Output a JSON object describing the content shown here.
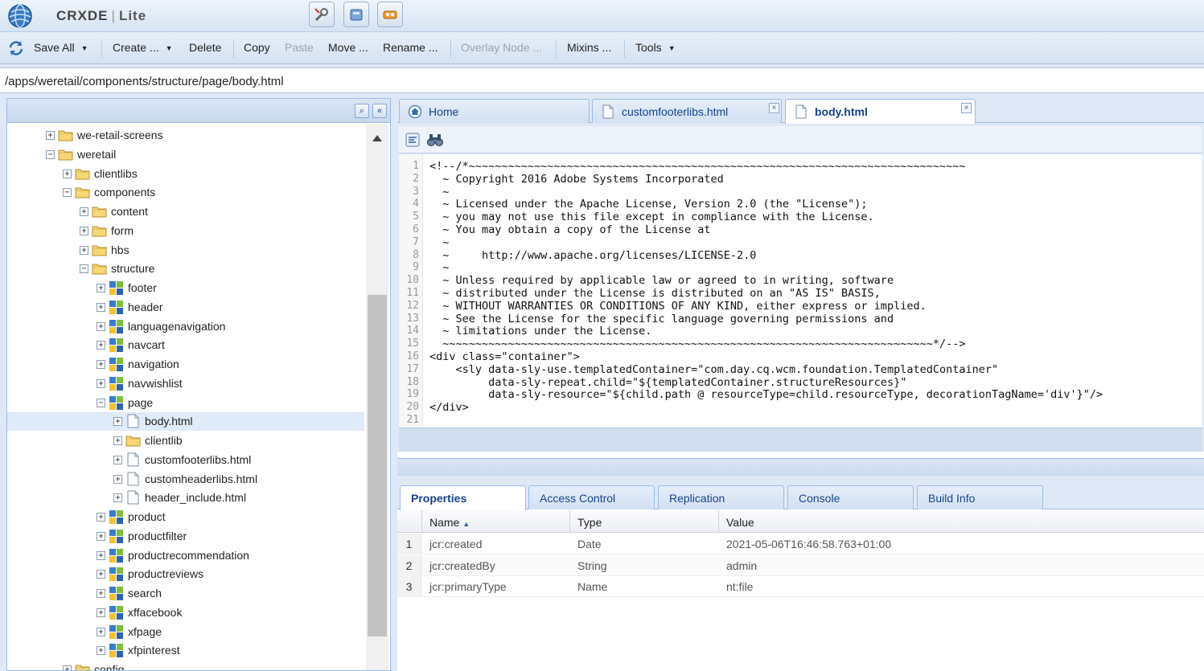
{
  "header": {
    "app_name": "CRXDE",
    "app_sub": "Lite"
  },
  "toolbar": {
    "save_all": "Save All",
    "create": "Create ...",
    "delete": "Delete",
    "copy": "Copy",
    "paste": "Paste",
    "move": "Move ...",
    "rename": "Rename ...",
    "overlay": "Overlay Node ...",
    "mixins": "Mixins ...",
    "tools": "Tools"
  },
  "path": "/apps/weretail/components/structure/page/body.html",
  "tree": {
    "items": [
      {
        "label": "we-retail-screens",
        "depth": 0,
        "icon": "folder-icon",
        "expanded": false
      },
      {
        "label": "weretail",
        "depth": 0,
        "icon": "folder-icon",
        "expanded": true
      },
      {
        "label": "clientlibs",
        "depth": 1,
        "icon": "folder-icon",
        "expanded": false
      },
      {
        "label": "components",
        "depth": 1,
        "icon": "folder-icon",
        "expanded": true
      },
      {
        "label": "content",
        "depth": 2,
        "icon": "folder-icon",
        "expanded": false
      },
      {
        "label": "form",
        "depth": 2,
        "icon": "folder-icon",
        "expanded": false
      },
      {
        "label": "hbs",
        "depth": 2,
        "icon": "folder-icon",
        "expanded": false
      },
      {
        "label": "structure",
        "depth": 2,
        "icon": "folder-icon",
        "expanded": true
      },
      {
        "label": "footer",
        "depth": 3,
        "icon": "component-icon",
        "expanded": false
      },
      {
        "label": "header",
        "depth": 3,
        "icon": "component-icon",
        "expanded": false
      },
      {
        "label": "languagenavigation",
        "depth": 3,
        "icon": "component-icon",
        "expanded": false
      },
      {
        "label": "navcart",
        "depth": 3,
        "icon": "component-icon",
        "expanded": false
      },
      {
        "label": "navigation",
        "depth": 3,
        "icon": "component-icon",
        "expanded": false
      },
      {
        "label": "navwishlist",
        "depth": 3,
        "icon": "component-icon",
        "expanded": false
      },
      {
        "label": "page",
        "depth": 3,
        "icon": "component-icon",
        "expanded": true
      },
      {
        "label": "body.html",
        "depth": 4,
        "icon": "file-icon",
        "expanded": false,
        "selected": true
      },
      {
        "label": "clientlib",
        "depth": 4,
        "icon": "folder-icon",
        "expanded": false
      },
      {
        "label": "customfooterlibs.html",
        "depth": 4,
        "icon": "file-icon",
        "expanded": false
      },
      {
        "label": "customheaderlibs.html",
        "depth": 4,
        "icon": "file-icon",
        "expanded": false
      },
      {
        "label": "header_include.html",
        "depth": 4,
        "icon": "file-icon",
        "expanded": false
      },
      {
        "label": "product",
        "depth": 3,
        "icon": "component-icon",
        "expanded": false
      },
      {
        "label": "productfilter",
        "depth": 3,
        "icon": "component-icon",
        "expanded": false
      },
      {
        "label": "productrecommendation",
        "depth": 3,
        "icon": "component-icon",
        "expanded": false
      },
      {
        "label": "productreviews",
        "depth": 3,
        "icon": "component-icon",
        "expanded": false
      },
      {
        "label": "search",
        "depth": 3,
        "icon": "component-icon",
        "expanded": false
      },
      {
        "label": "xffacebook",
        "depth": 3,
        "icon": "component-icon",
        "expanded": false
      },
      {
        "label": "xfpage",
        "depth": 3,
        "icon": "component-icon",
        "expanded": false
      },
      {
        "label": "xfpinterest",
        "depth": 3,
        "icon": "component-icon",
        "expanded": false
      },
      {
        "label": "config",
        "depth": 1,
        "icon": "folder-icon",
        "expanded": false
      }
    ]
  },
  "editor": {
    "tabs": [
      {
        "label": "Home",
        "icon": "home-icon",
        "active": false,
        "closable": false
      },
      {
        "label": "customfooterlibs.html",
        "icon": "file-icon",
        "active": false,
        "closable": true
      },
      {
        "label": "body.html",
        "icon": "file-icon",
        "active": true,
        "closable": true
      }
    ],
    "lines": [
      "<!--/*~~~~~~~~~~~~~~~~~~~~~~~~~~~~~~~~~~~~~~~~~~~~~~~~~~~~~~~~~~~~~~~~~~~~~~~~~~~~",
      "  ~ Copyright 2016 Adobe Systems Incorporated",
      "  ~",
      "  ~ Licensed under the Apache License, Version 2.0 (the \"License\");",
      "  ~ you may not use this file except in compliance with the License.",
      "  ~ You may obtain a copy of the License at",
      "  ~",
      "  ~     http://www.apache.org/licenses/LICENSE-2.0",
      "  ~",
      "  ~ Unless required by applicable law or agreed to in writing, software",
      "  ~ distributed under the License is distributed on an \"AS IS\" BASIS,",
      "  ~ WITHOUT WARRANTIES OR CONDITIONS OF ANY KIND, either express or implied.",
      "  ~ See the License for the specific language governing permissions and",
      "  ~ limitations under the License.",
      "  ~~~~~~~~~~~~~~~~~~~~~~~~~~~~~~~~~~~~~~~~~~~~~~~~~~~~~~~~~~~~~~~~~~~~~~~~~~~*/-->",
      "<div class=\"container\">",
      "    <sly data-sly-use.templatedContainer=\"com.day.cq.wcm.foundation.TemplatedContainer\"",
      "         data-sly-repeat.child=\"${templatedContainer.structureResources}\"",
      "         data-sly-resource=\"${child.path @ resourceType=child.resourceType, decorationTagName='div'}\"/>",
      "</div>",
      ""
    ]
  },
  "bottom": {
    "tabs": [
      {
        "label": "Properties",
        "active": true
      },
      {
        "label": "Access Control",
        "active": false
      },
      {
        "label": "Replication",
        "active": false
      },
      {
        "label": "Console",
        "active": false
      },
      {
        "label": "Build Info",
        "active": false
      }
    ],
    "columns": {
      "name": "Name",
      "type": "Type",
      "value": "Value"
    },
    "rows": [
      {
        "num": "1",
        "name": "jcr:created",
        "type": "Date",
        "value": "2021-05-06T16:46:58.763+01:00"
      },
      {
        "num": "2",
        "name": "jcr:createdBy",
        "type": "String",
        "value": "admin"
      },
      {
        "num": "3",
        "name": "jcr:primaryType",
        "type": "Name",
        "value": "nt:file"
      }
    ]
  },
  "colors": {
    "accent": "#15428b",
    "panel_border": "#99bbe8",
    "selected_row": "#dfebf8"
  }
}
